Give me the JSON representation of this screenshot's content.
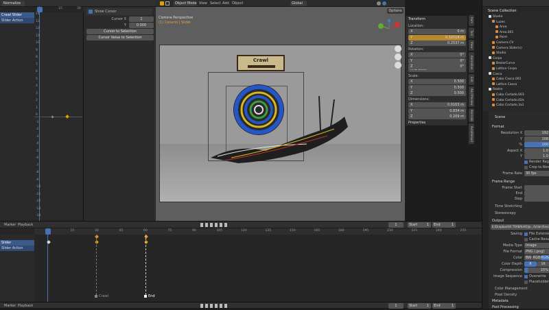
{
  "graph_editor": {
    "mode": "Normalize",
    "ticks": [
      "1",
      "15",
      "30"
    ],
    "channels": [
      "Crawl Slider",
      "Slider Action"
    ],
    "y_ticks": [
      "14",
      "13",
      "12",
      "11",
      "10",
      "9",
      "8",
      "7",
      "6",
      "5",
      "4",
      "3",
      "2",
      "1",
      "0",
      "-1",
      "-2",
      "-3",
      "-4",
      "-5",
      "-6",
      "-7",
      "-8",
      "-9",
      "-10",
      "-11",
      "-12",
      "-13",
      "-14"
    ],
    "cursor_panel": {
      "show_cursor": "Show Cursor",
      "cursor_x_label": "Cursor X",
      "cursor_x": "1",
      "y_label": "Y",
      "y_value": "0.000",
      "btn1": "Cursor to Selection",
      "btn2": "Cursor Value to Selection"
    }
  },
  "viewport": {
    "mode": "Object Mode",
    "menus": [
      "View",
      "Select",
      "Add",
      "Object"
    ],
    "orientation": "Global",
    "options": "Options",
    "camera_label": "Camera Perspective",
    "collection_label": "(1) Cenario | Slider",
    "sign_text": "Crawl",
    "side_tabs": [
      "Item",
      "Tool",
      "View",
      "Animation",
      "Edit",
      "Add Preview",
      "Animate",
      "AutoReload"
    ]
  },
  "transform": {
    "title": "Transform",
    "location": "Location:",
    "loc": [
      {
        "axis": "X",
        "value": "0 m"
      },
      {
        "axis": "Y",
        "value": "0.32518 m"
      },
      {
        "axis": "Z",
        "value": "0.2537 m"
      }
    ],
    "rotation": "Rotation:",
    "rot": [
      {
        "axis": "X",
        "value": "0°"
      },
      {
        "axis": "Y",
        "value": "0°"
      },
      {
        "axis": "Z",
        "value": "0°"
      }
    ],
    "euler": "XYZ Euler",
    "scale": "Scale:",
    "scl": [
      {
        "axis": "X",
        "value": "0.500"
      },
      {
        "axis": "Y",
        "value": "0.500"
      },
      {
        "axis": "Z",
        "value": "0.500"
      }
    ],
    "dimensions": "Dimensions:",
    "dim": [
      {
        "axis": "X",
        "value": "0.0163 m"
      },
      {
        "axis": "Y",
        "value": "0.834 m"
      },
      {
        "axis": "Z",
        "value": "0.209 m"
      }
    ],
    "properties": "Properties"
  },
  "outliner": {
    "title": "Scene Collection",
    "items": [
      {
        "name": "Studio",
        "depth": 1
      },
      {
        "name": "Luzes",
        "depth": 2
      },
      {
        "name": "Area",
        "depth": 3
      },
      {
        "name": "Area.001",
        "depth": 3
      },
      {
        "name": "Point",
        "depth": 3
      },
      {
        "name": "Camera.CV",
        "depth": 2
      },
      {
        "name": "Camera Slider(s)",
        "depth": 2
      },
      {
        "name": "Studio",
        "depth": 2
      },
      {
        "name": "Corpo",
        "depth": 1
      },
      {
        "name": "BezierCurve",
        "depth": 2
      },
      {
        "name": "Lattice Corpo",
        "depth": 2
      },
      {
        "name": "Casca",
        "depth": 1
      },
      {
        "name": "Cabo Casca.001",
        "depth": 2
      },
      {
        "name": "Lattice Casca",
        "depth": 2
      },
      {
        "name": "Rastro",
        "depth": 1
      },
      {
        "name": "Cabo Cortado.003",
        "depth": 2
      },
      {
        "name": "Cabo Cortado.02a",
        "depth": 2
      },
      {
        "name": "Cabo Cortado.3a1",
        "depth": 2
      }
    ]
  },
  "properties": {
    "scene": "Scene",
    "format_title": "Format",
    "rows": [
      {
        "label": "Resolution X",
        "value": "192"
      },
      {
        "label": "Y",
        "value": "108"
      },
      {
        "label": "%",
        "value": "100"
      },
      {
        "label": "Aspect X",
        "value": "1.0"
      },
      {
        "label": "Y",
        "value": "1.0"
      }
    ],
    "render_region": "Render Region",
    "crop": "Crop to Render Region",
    "frame_rate_label": "Frame Rate",
    "frame_rate": "30 fps",
    "frame_range": "Frame Range",
    "frame_start": "Frame Start",
    "end": "End",
    "step": "Step",
    "time_stretching": "Time Stretching",
    "stereoscopy": "Stereoscopy",
    "output": "Output",
    "path": "E:\\Dropbox\\04 TRABALHO\\Jo...Action\\Snail_Wave\\",
    "saving": "Saving",
    "file_ext": "File Extensions",
    "cache": "Cache Result",
    "media_type_label": "Media Type",
    "media_type": "Image",
    "file_format_label": "File Format",
    "file_format": "PNG (.png)",
    "color_label": "Color",
    "color_opts": [
      "BW",
      "RGB",
      "RGBA"
    ],
    "depth_label": "Color Depth",
    "depth_opts": [
      "8",
      "16"
    ],
    "compression_label": "Compression",
    "compression": "15%",
    "image_seq": "Image Sequence",
    "overwrite": "Overwrite",
    "placeholders": "Placeholders",
    "color_mgmt": "Color Management",
    "pixel_density": "Pixel Density",
    "metadata": "Metadata",
    "post_processing": "Post Processing"
  },
  "timeline": {
    "menus": [
      "Marker",
      "Playback"
    ],
    "frame": "1",
    "start_label": "Start",
    "start": "1",
    "end_label": "End",
    "end": "1",
    "ticks": [
      "1",
      "15",
      "30",
      "45",
      "60",
      "75",
      "90",
      "105",
      "120",
      "135",
      "150",
      "165",
      "180",
      "195",
      "210",
      "225",
      "240",
      "255"
    ],
    "tracks": [
      "Slider",
      "Slider Action"
    ],
    "markers": [
      "Crawl",
      "End"
    ]
  },
  "bottom_bar": {
    "menus": [
      "Marker",
      "Playback"
    ],
    "frame": "1",
    "start_label": "Start",
    "start": "1",
    "end_label": "End",
    "end": "1"
  },
  "colors": {
    "accent": "#4772b3",
    "keyframe": "#e0a000",
    "viewport_bg": "#6b6b6b",
    "selection": "#e06b4a"
  }
}
